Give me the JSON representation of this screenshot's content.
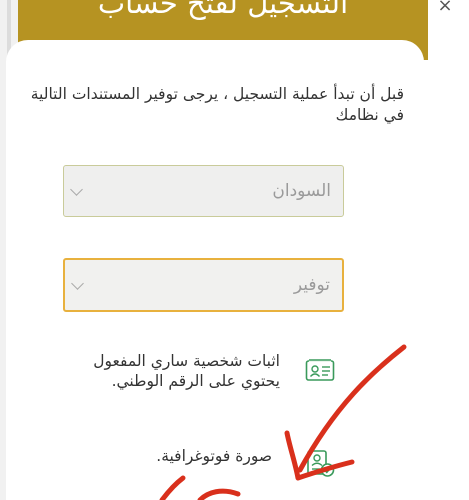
{
  "header": {
    "title": "التسجيل لفتح حساب",
    "close_symbol": "×"
  },
  "intro": {
    "text": "قبل أن تبدأ عملية التسجيل ، يرجى توفير المستندات التالية في نظامك"
  },
  "country_select": {
    "value": "السودان"
  },
  "provide_select": {
    "value": "توفير"
  },
  "documents": [
    {
      "label": "اثبات شخصية ساري المفعول يحتوي على الرقم الوطني.",
      "icon": "id-card-icon"
    },
    {
      "label": "صورة فوتوغرافية.",
      "icon": "photo-check-icon"
    }
  ],
  "colors": {
    "header_gold": "#b69322",
    "focus_border": "#e8b13e",
    "icon_green": "#3a9a5b",
    "annotation_red": "#d9301c"
  }
}
